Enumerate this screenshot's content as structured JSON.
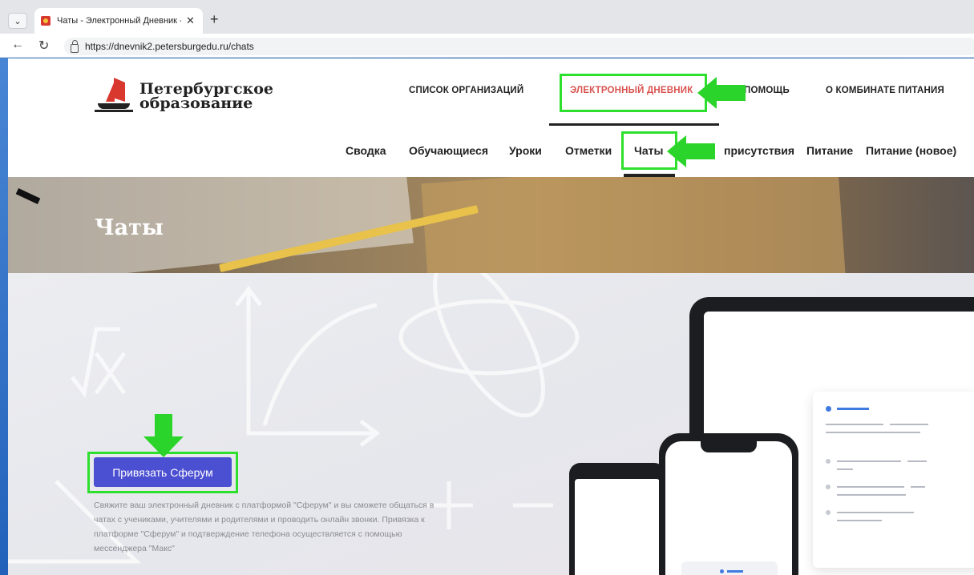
{
  "browser": {
    "tab_title": "Чаты - Электронный Дневник - ",
    "url": "https://dnevnik2.petersburgedu.ru/chats"
  },
  "logo": {
    "line1": "Петербургское",
    "line2": "образование"
  },
  "top_nav": [
    {
      "label": "СПИСОК ОРГАНИЗАЦИЙ"
    },
    {
      "label": "ЭЛЕКТРОННЫЙ ДНЕВНИК",
      "active": true
    },
    {
      "label": "ПОМОЩЬ"
    },
    {
      "label": "О КОМБИНАТЕ ПИТАНИЯ"
    }
  ],
  "sub_nav": [
    {
      "label": "Сводка"
    },
    {
      "label": "Обучающиеся"
    },
    {
      "label": "Уроки"
    },
    {
      "label": "Отметки"
    },
    {
      "label": "Чаты",
      "active": true
    },
    {
      "label": "присутствия"
    },
    {
      "label": "Питание"
    },
    {
      "label": "Питание (новое)"
    }
  ],
  "banner": {
    "title": "Чаты"
  },
  "main": {
    "bind_button": "Привязать Сферум",
    "description": "Свяжите ваш электронный дневник с платформой \"Сферум\" и вы сможете общаться в чатах с учениками, учителями и родителями и проводить онлайн звонки. Привязка к платформе \"Сферум\" и подтверждение телефона осуществляется с помощью мессенджера \"Макс\""
  },
  "colors": {
    "highlight": "#2ee02e",
    "active_nav": "#d9534f",
    "button": "#4b4fd1"
  }
}
